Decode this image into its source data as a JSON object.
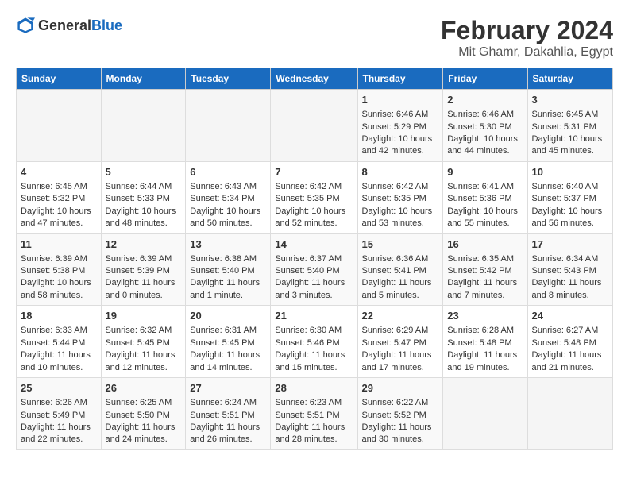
{
  "logo": {
    "general": "General",
    "blue": "Blue"
  },
  "header": {
    "month_year": "February 2024",
    "location": "Mit Ghamr, Dakahlia, Egypt"
  },
  "days_of_week": [
    "Sunday",
    "Monday",
    "Tuesday",
    "Wednesday",
    "Thursday",
    "Friday",
    "Saturday"
  ],
  "weeks": [
    [
      {
        "day": "",
        "info": ""
      },
      {
        "day": "",
        "info": ""
      },
      {
        "day": "",
        "info": ""
      },
      {
        "day": "",
        "info": ""
      },
      {
        "day": "1",
        "info": "Sunrise: 6:46 AM\nSunset: 5:29 PM\nDaylight: 10 hours and 42 minutes."
      },
      {
        "day": "2",
        "info": "Sunrise: 6:46 AM\nSunset: 5:30 PM\nDaylight: 10 hours and 44 minutes."
      },
      {
        "day": "3",
        "info": "Sunrise: 6:45 AM\nSunset: 5:31 PM\nDaylight: 10 hours and 45 minutes."
      }
    ],
    [
      {
        "day": "4",
        "info": "Sunrise: 6:45 AM\nSunset: 5:32 PM\nDaylight: 10 hours and 47 minutes."
      },
      {
        "day": "5",
        "info": "Sunrise: 6:44 AM\nSunset: 5:33 PM\nDaylight: 10 hours and 48 minutes."
      },
      {
        "day": "6",
        "info": "Sunrise: 6:43 AM\nSunset: 5:34 PM\nDaylight: 10 hours and 50 minutes."
      },
      {
        "day": "7",
        "info": "Sunrise: 6:42 AM\nSunset: 5:35 PM\nDaylight: 10 hours and 52 minutes."
      },
      {
        "day": "8",
        "info": "Sunrise: 6:42 AM\nSunset: 5:35 PM\nDaylight: 10 hours and 53 minutes."
      },
      {
        "day": "9",
        "info": "Sunrise: 6:41 AM\nSunset: 5:36 PM\nDaylight: 10 hours and 55 minutes."
      },
      {
        "day": "10",
        "info": "Sunrise: 6:40 AM\nSunset: 5:37 PM\nDaylight: 10 hours and 56 minutes."
      }
    ],
    [
      {
        "day": "11",
        "info": "Sunrise: 6:39 AM\nSunset: 5:38 PM\nDaylight: 10 hours and 58 minutes."
      },
      {
        "day": "12",
        "info": "Sunrise: 6:39 AM\nSunset: 5:39 PM\nDaylight: 11 hours and 0 minutes."
      },
      {
        "day": "13",
        "info": "Sunrise: 6:38 AM\nSunset: 5:40 PM\nDaylight: 11 hours and 1 minute."
      },
      {
        "day": "14",
        "info": "Sunrise: 6:37 AM\nSunset: 5:40 PM\nDaylight: 11 hours and 3 minutes."
      },
      {
        "day": "15",
        "info": "Sunrise: 6:36 AM\nSunset: 5:41 PM\nDaylight: 11 hours and 5 minutes."
      },
      {
        "day": "16",
        "info": "Sunrise: 6:35 AM\nSunset: 5:42 PM\nDaylight: 11 hours and 7 minutes."
      },
      {
        "day": "17",
        "info": "Sunrise: 6:34 AM\nSunset: 5:43 PM\nDaylight: 11 hours and 8 minutes."
      }
    ],
    [
      {
        "day": "18",
        "info": "Sunrise: 6:33 AM\nSunset: 5:44 PM\nDaylight: 11 hours and 10 minutes."
      },
      {
        "day": "19",
        "info": "Sunrise: 6:32 AM\nSunset: 5:45 PM\nDaylight: 11 hours and 12 minutes."
      },
      {
        "day": "20",
        "info": "Sunrise: 6:31 AM\nSunset: 5:45 PM\nDaylight: 11 hours and 14 minutes."
      },
      {
        "day": "21",
        "info": "Sunrise: 6:30 AM\nSunset: 5:46 PM\nDaylight: 11 hours and 15 minutes."
      },
      {
        "day": "22",
        "info": "Sunrise: 6:29 AM\nSunset: 5:47 PM\nDaylight: 11 hours and 17 minutes."
      },
      {
        "day": "23",
        "info": "Sunrise: 6:28 AM\nSunset: 5:48 PM\nDaylight: 11 hours and 19 minutes."
      },
      {
        "day": "24",
        "info": "Sunrise: 6:27 AM\nSunset: 5:48 PM\nDaylight: 11 hours and 21 minutes."
      }
    ],
    [
      {
        "day": "25",
        "info": "Sunrise: 6:26 AM\nSunset: 5:49 PM\nDaylight: 11 hours and 22 minutes."
      },
      {
        "day": "26",
        "info": "Sunrise: 6:25 AM\nSunset: 5:50 PM\nDaylight: 11 hours and 24 minutes."
      },
      {
        "day": "27",
        "info": "Sunrise: 6:24 AM\nSunset: 5:51 PM\nDaylight: 11 hours and 26 minutes."
      },
      {
        "day": "28",
        "info": "Sunrise: 6:23 AM\nSunset: 5:51 PM\nDaylight: 11 hours and 28 minutes."
      },
      {
        "day": "29",
        "info": "Sunrise: 6:22 AM\nSunset: 5:52 PM\nDaylight: 11 hours and 30 minutes."
      },
      {
        "day": "",
        "info": ""
      },
      {
        "day": "",
        "info": ""
      }
    ]
  ]
}
